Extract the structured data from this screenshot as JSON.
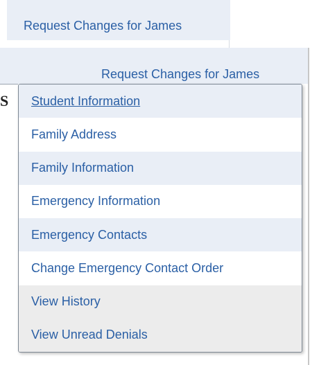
{
  "header": {
    "request_link_back": "Request Changes for James",
    "request_link": "Request Changes for James"
  },
  "clipped_heading_letter": "S",
  "menu": {
    "items": [
      {
        "label": "Student Information",
        "active": true
      },
      {
        "label": "Family Address"
      },
      {
        "label": "Family Information"
      },
      {
        "label": "Emergency Information"
      },
      {
        "label": "Emergency Contacts"
      },
      {
        "label": "Change Emergency Contact Order"
      },
      {
        "label": "View History"
      },
      {
        "label": "View Unread Denials"
      }
    ]
  },
  "colors": {
    "link": "#2a5fa5",
    "row_alt": "#e9eef6",
    "row_gray": "#ececec",
    "menu_border": "#7d8793"
  }
}
